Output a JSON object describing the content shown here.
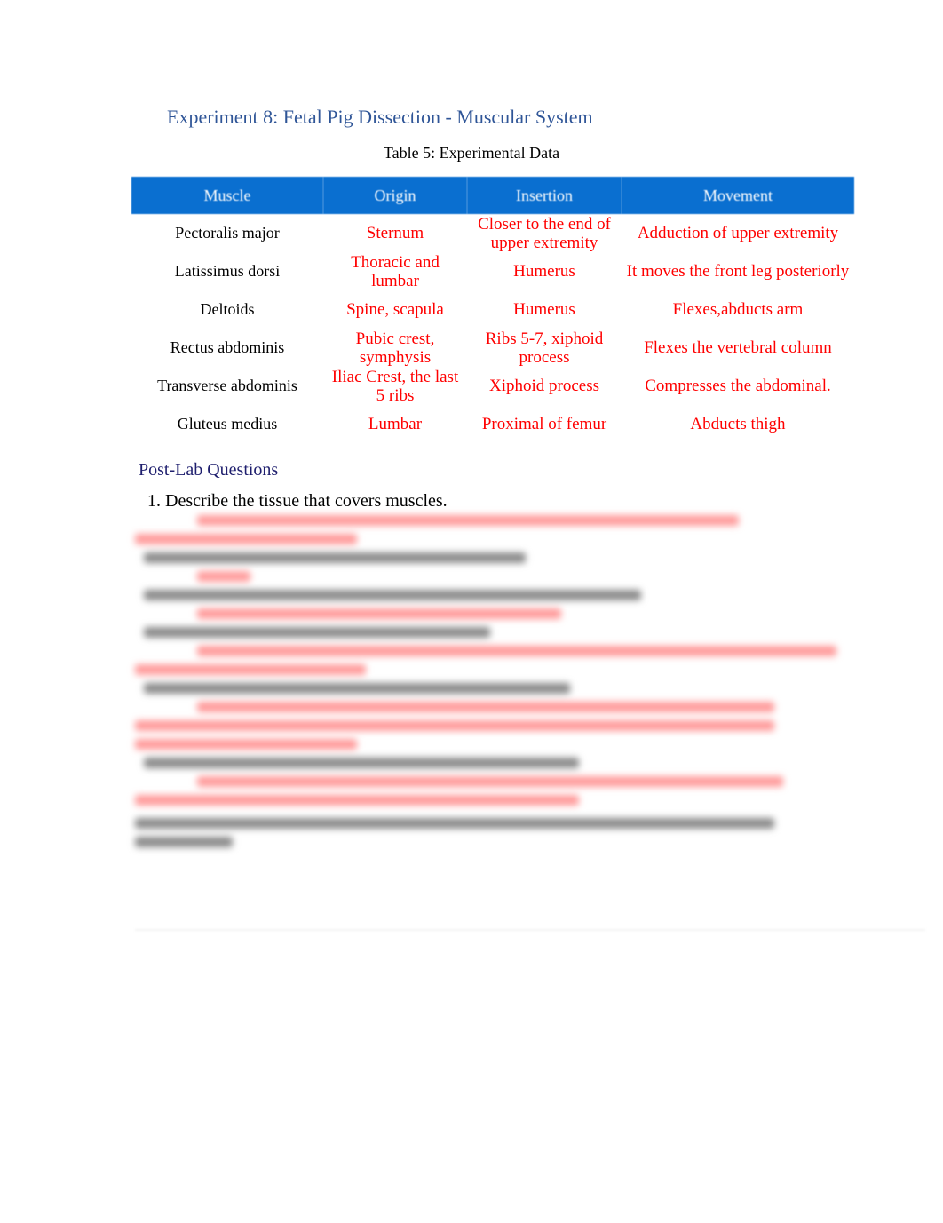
{
  "document": {
    "title": "Experiment 8: Fetal Pig Dissection - Muscular System",
    "table_caption": "Table 5: Experimental Data",
    "table": {
      "headers": [
        "Muscle",
        "Origin",
        "Insertion",
        "Movement"
      ],
      "rows": [
        {
          "muscle": "Pectoralis major",
          "origin": "Sternum",
          "insertion": "Closer to the end of upper extremity",
          "movement": "Adduction of upper extremity"
        },
        {
          "muscle": "Latissimus dorsi",
          "origin": "Thoracic and lumbar",
          "insertion": "Humerus",
          "movement": "It moves the front leg posteriorly"
        },
        {
          "muscle": "Deltoids",
          "origin": "Spine, scapula",
          "insertion": "Humerus",
          "movement": "Flexes,abducts arm"
        },
        {
          "muscle": "Rectus abdominis",
          "origin": "Pubic crest, symphysis",
          "insertion": "Ribs 5-7, xiphoid process",
          "movement": "Flexes the vertebral column"
        },
        {
          "muscle": "Transverse abdominis",
          "origin": "Iliac Crest, the last 5 ribs",
          "insertion": "Xiphoid process",
          "movement": "Compresses the abdominal."
        },
        {
          "muscle": "Gluteus medius",
          "origin": "Lumbar",
          "insertion": "Proximal of femur",
          "movement": "Abducts thigh"
        }
      ]
    },
    "post_lab": {
      "heading": "Post-Lab Questions",
      "question_1": "1. Describe the tissue that covers muscles."
    }
  }
}
